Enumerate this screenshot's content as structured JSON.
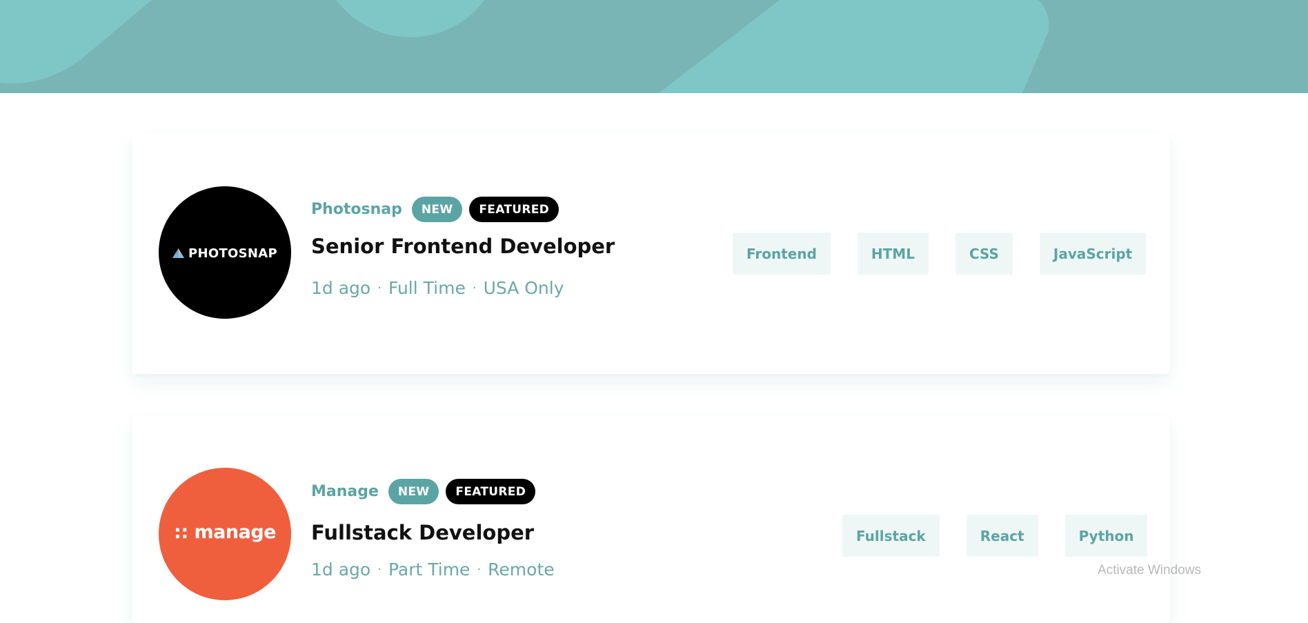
{
  "header": {
    "background_color": "#7fc6c6",
    "shape_color": "#7ab5b5"
  },
  "jobs": [
    {
      "company": "Photosnap",
      "logo_text": "PHOTOSNAP",
      "logo_color": "#000000",
      "badge_new": "NEW",
      "badge_featured": "FEATURED",
      "position": "Senior Frontend Developer",
      "posted": "1d ago",
      "contract": "Full Time",
      "location": "USA Only",
      "tags": [
        "Frontend",
        "HTML",
        "CSS",
        "JavaScript"
      ]
    },
    {
      "company": "Manage",
      "logo_text": ":: manage",
      "logo_color": "#ef5f3d",
      "badge_new": "NEW",
      "badge_featured": "FEATURED",
      "position": "Fullstack Developer",
      "posted": "1d ago",
      "contract": "Part Time",
      "location": "Remote",
      "tags": [
        "Fullstack",
        "React",
        "Python"
      ]
    }
  ],
  "meta_separator": "·",
  "system": {
    "watermark": "Activate Windows"
  }
}
